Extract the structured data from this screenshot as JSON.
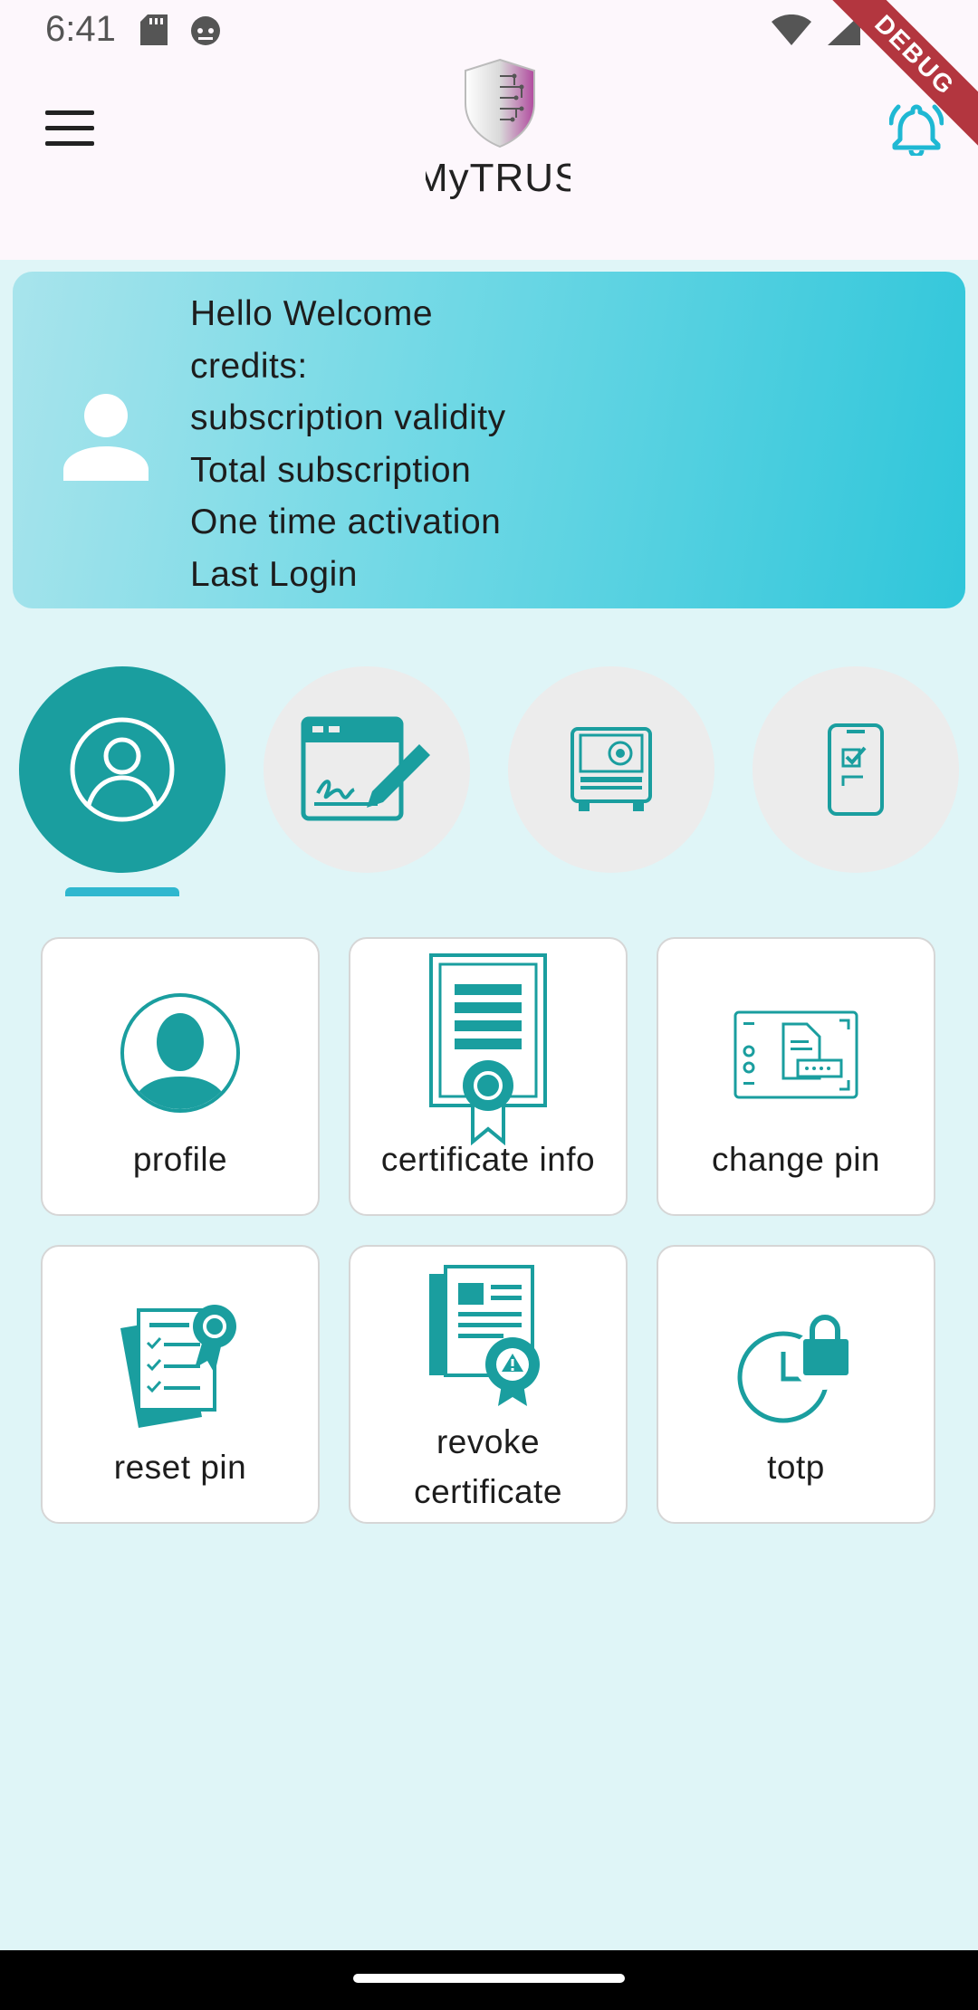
{
  "status_bar": {
    "time": "6:41",
    "debug_label": "DEBUG"
  },
  "app_bar": {
    "logo_text": "MyTRUST"
  },
  "welcome_card": {
    "lines": [
      "Hello Welcome",
      "credits:",
      "subscription validity",
      "Total subscription",
      "One time activation",
      "Last Login"
    ]
  },
  "categories": [
    {
      "icon": "user-circle-icon",
      "active": true
    },
    {
      "icon": "e-sign-icon",
      "active": false
    },
    {
      "icon": "vault-icon",
      "active": false
    },
    {
      "icon": "mobile-check-icon",
      "active": false
    }
  ],
  "tiles": [
    {
      "label": "profile",
      "icon": "profile-icon"
    },
    {
      "label": "certificate info",
      "icon": "certificate-icon"
    },
    {
      "label": "change pin",
      "icon": "change-pin-icon"
    },
    {
      "label": "reset pin",
      "icon": "reset-pin-icon"
    },
    {
      "label": "revoke certificate",
      "icon": "revoke-certificate-icon"
    },
    {
      "label": "totp",
      "icon": "totp-icon"
    }
  ],
  "colors": {
    "teal": "#1a9e9f",
    "accent_cyan": "#2fb7cf",
    "background": "#dff5f7"
  }
}
